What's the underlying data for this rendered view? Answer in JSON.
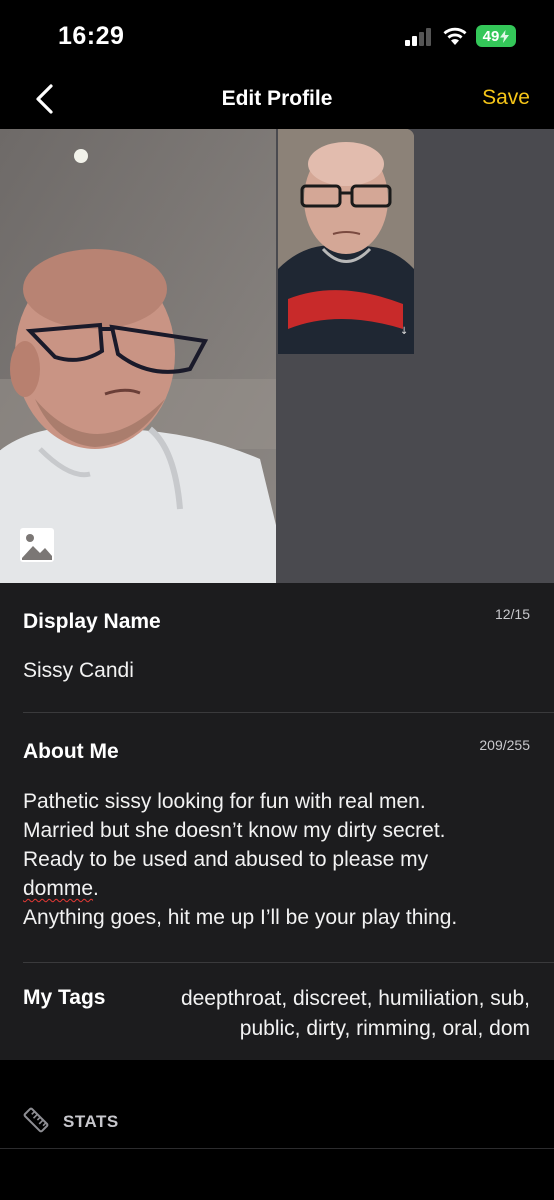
{
  "status_bar": {
    "time": "16:29",
    "battery": "49"
  },
  "nav": {
    "title": "Edit Profile",
    "save_label": "Save"
  },
  "display_name": {
    "label": "Display Name",
    "counter": "12/15",
    "value": "Sissy Candi"
  },
  "about_me": {
    "label": "About Me",
    "counter": "209/255",
    "lines": [
      "Pathetic sissy looking for fun with real men.",
      "Married but she doesn’t know my dirty secret.",
      "Ready to be used and abused to please my",
      "domme",
      ".",
      "Anything goes, hit me up I’ll be your play thing."
    ]
  },
  "tags": {
    "label": "My Tags",
    "line1": "deepthroat, discreet, humiliation, sub,",
    "line2": "public, dirty, rimming, oral, dom"
  },
  "stats": {
    "label": "STATS"
  },
  "colors": {
    "accent": "#f5c518",
    "card_bg": "#1c1c1e",
    "empty_slot": "#4a4a4f",
    "battery": "#34c759"
  }
}
